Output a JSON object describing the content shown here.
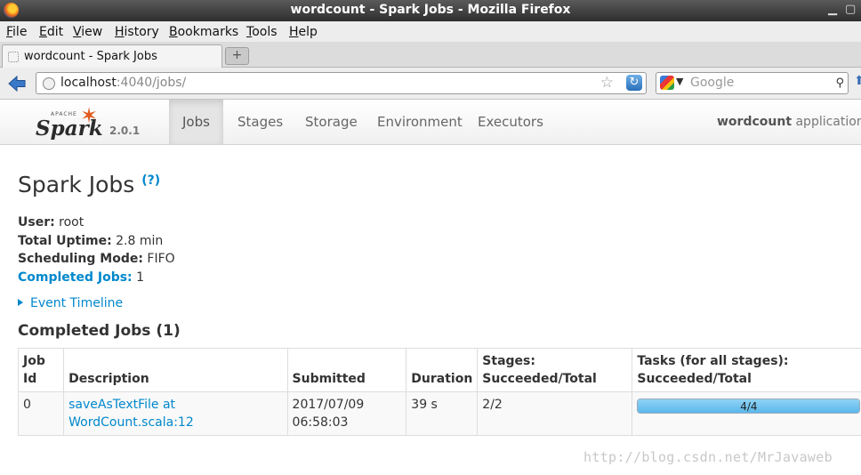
{
  "window": {
    "title": "wordcount - Spark Jobs - Mozilla Firefox"
  },
  "menu": [
    "File",
    "Edit",
    "View",
    "History",
    "Bookmarks",
    "Tools",
    "Help"
  ],
  "tab": {
    "label": "wordcount - Spark Jobs",
    "new_tab": "+"
  },
  "urlbar": {
    "host": "localhost",
    "rest": ":4040/jobs/"
  },
  "search": {
    "placeholder": "Google"
  },
  "spark": {
    "logo_apache": "APACHE",
    "logo_word": "Spark",
    "version": "2.0.1",
    "tabs": [
      "Jobs",
      "Stages",
      "Storage",
      "Environment",
      "Executors"
    ],
    "active_tab": "Jobs",
    "app_name": "wordcount",
    "app_suffix": " application U"
  },
  "page": {
    "title": "Spark Jobs",
    "help": "(?)",
    "summary": [
      {
        "label": "User:",
        "value": " root"
      },
      {
        "label": "Total Uptime:",
        "value": " 2.8 min"
      },
      {
        "label": "Scheduling Mode:",
        "value": " FIFO"
      },
      {
        "label": "Completed Jobs:",
        "value": " 1"
      }
    ],
    "event_timeline": "Event Timeline",
    "section_title": "Completed Jobs (1)"
  },
  "table": {
    "headers": [
      [
        "Job",
        "Id"
      ],
      [
        "Description"
      ],
      [
        "Submitted"
      ],
      [
        "Duration"
      ],
      [
        "Stages:",
        "Succeeded/Total"
      ],
      [
        "Tasks (for all stages):",
        "Succeeded/Total"
      ]
    ],
    "rows": [
      {
        "job_id": "0",
        "description": "saveAsTextFile at WordCount.scala:12",
        "submitted": [
          "2017/07/09",
          "06:58:03"
        ],
        "duration": "39 s",
        "stages": "2/2",
        "tasks": "4/4",
        "tasks_fraction": 1.0
      }
    ]
  },
  "watermark": "http://blog.csdn.net/MrJavaweb"
}
